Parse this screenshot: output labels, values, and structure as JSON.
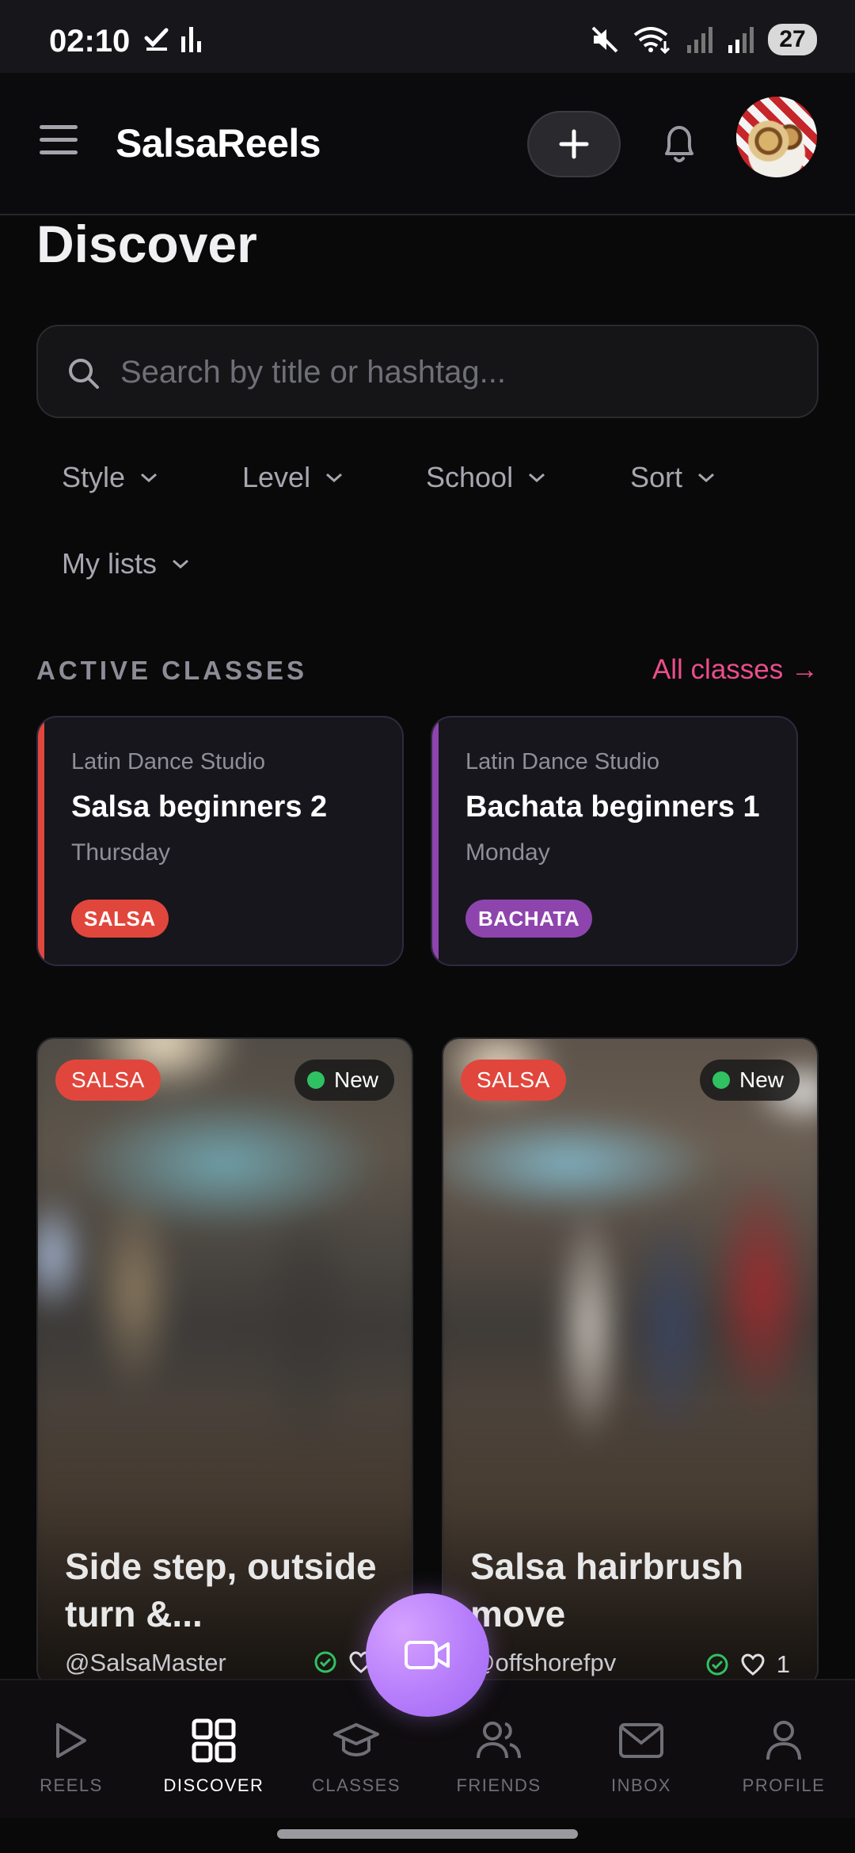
{
  "status_bar": {
    "time": "02:10",
    "battery": "27"
  },
  "header": {
    "brand": "SalsaReels"
  },
  "page": {
    "title": "Discover"
  },
  "search": {
    "placeholder": "Search by title or hashtag..."
  },
  "filters": [
    {
      "label": "Style"
    },
    {
      "label": "Level"
    },
    {
      "label": "School"
    },
    {
      "label": "Sort"
    },
    {
      "label": "My lists"
    }
  ],
  "active_classes": {
    "heading": "ACTIVE CLASSES",
    "link": "All classes →",
    "items": [
      {
        "school": "Latin Dance Studio",
        "title": "Salsa beginners 2",
        "day": "Thursday",
        "tag": "SALSA",
        "color": "#e1463c"
      },
      {
        "school": "Latin Dance Studio",
        "title": "Bachata beginners 1",
        "day": "Monday",
        "tag": "BACHATA",
        "color": "#8e44ad"
      }
    ]
  },
  "reels": [
    {
      "tag": "SALSA",
      "badge": "New",
      "title": "Side step, outside turn &...",
      "user": "@SalsaMaster",
      "likes": ""
    },
    {
      "tag": "SALSA",
      "badge": "New",
      "title": "Salsa hairbrush move",
      "user": "@offshorefpv",
      "likes": "1"
    }
  ],
  "bottom_nav": [
    {
      "label": "REELS",
      "icon": "play-icon"
    },
    {
      "label": "DISCOVER",
      "icon": "grid-icon",
      "active": true
    },
    {
      "label": "CLASSES",
      "icon": "graduation-cap-icon"
    },
    {
      "label": "FRIENDS",
      "icon": "users-icon"
    },
    {
      "label": "INBOX",
      "icon": "mail-icon"
    },
    {
      "label": "PROFILE",
      "icon": "user-icon"
    }
  ],
  "colors": {
    "accent": "#ec4d8a",
    "salsa": "#e1463c",
    "bachata": "#8e44ad",
    "fab": "#b67dfb",
    "new_dot": "#30c162"
  }
}
